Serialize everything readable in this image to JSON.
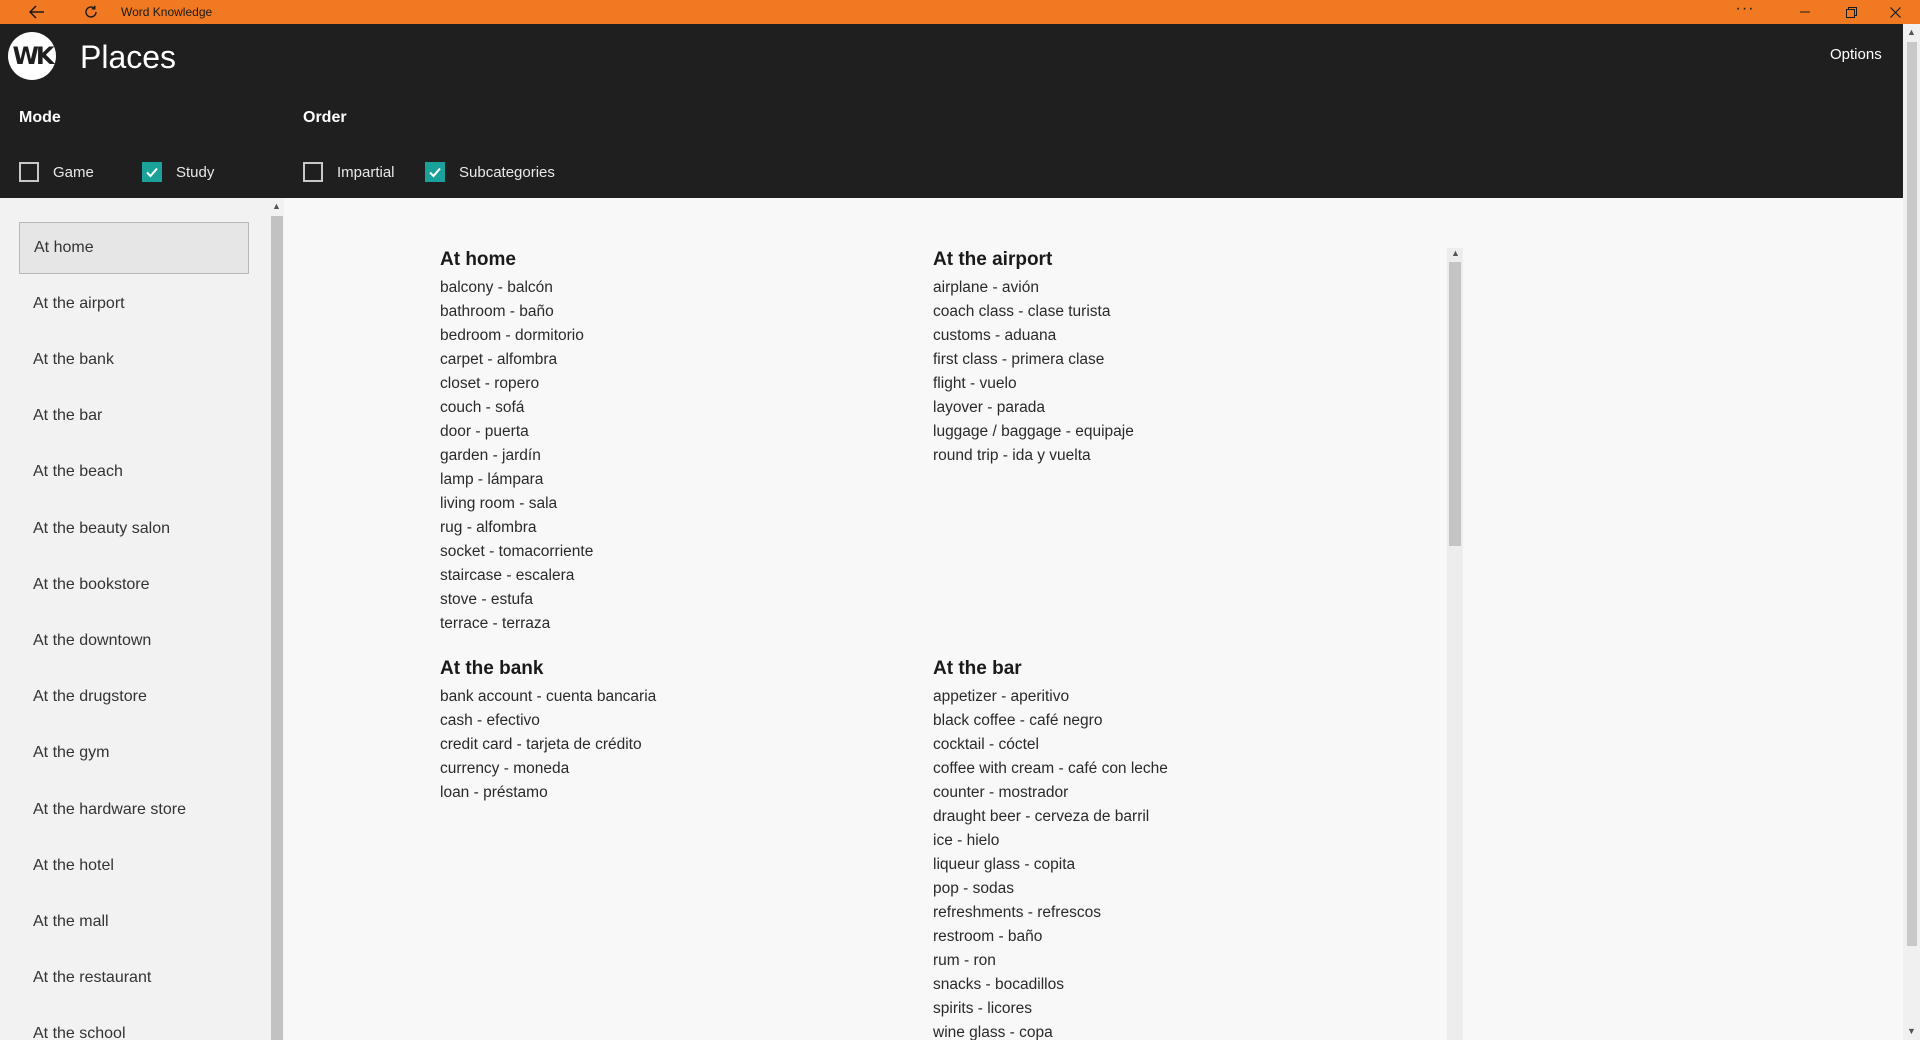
{
  "window": {
    "title": "Word Knowledge",
    "more_glyph": "···",
    "accent_color": "#f07921"
  },
  "header": {
    "logo_text": "WK",
    "page_title": "Places",
    "options_label": "Options",
    "mode": {
      "label": "Mode",
      "options": [
        {
          "label": "Game",
          "checked": false
        },
        {
          "label": "Study",
          "checked": true
        }
      ]
    },
    "order": {
      "label": "Order",
      "options": [
        {
          "label": "Impartial",
          "checked": false
        },
        {
          "label": "Subcategories",
          "checked": true
        }
      ]
    },
    "check_color": "#1aa199"
  },
  "sidebar": {
    "selected": "At home",
    "items": [
      "At home",
      "At the airport",
      "At the bank",
      "At the bar",
      "At the beach",
      "At the beauty salon",
      "At the bookstore",
      "At the downtown",
      "At the drugstore",
      "At the gym",
      "At the hardware store",
      "At the hotel",
      "At the mall",
      "At the restaurant",
      "At the school"
    ]
  },
  "categories": [
    {
      "title": "At home",
      "words": [
        "balcony - balcón",
        "bathroom - baño",
        "bedroom - dormitorio",
        "carpet - alfombra",
        "closet - ropero",
        "couch - sofá",
        "door - puerta",
        "garden - jardín",
        "lamp - lámpara",
        "living room - sala",
        "rug - alfombra",
        "socket - tomacorriente",
        "staircase - escalera",
        "stove - estufa",
        "terrace - terraza"
      ]
    },
    {
      "title": "At the airport",
      "words": [
        "airplane - avión",
        "coach class - clase turista",
        "customs - aduana",
        "first class - primera clase",
        "flight - vuelo",
        "layover - parada",
        "luggage / baggage - equipaje",
        "round trip - ida y vuelta"
      ]
    },
    {
      "title": "At the bank",
      "words": [
        "bank account - cuenta bancaria",
        "cash - efectivo",
        "credit card - tarjeta de crédito",
        "currency - moneda",
        "loan - préstamo"
      ]
    },
    {
      "title": "At the bar",
      "words": [
        "appetizer - aperitivo",
        "black coffee - café negro",
        "cocktail - cóctel",
        "coffee with cream - café con leche",
        "counter - mostrador",
        "draught beer - cerveza de barril",
        "ice - hielo",
        "liqueur glass - copita",
        "pop - sodas",
        "refreshments - refrescos",
        "restroom - baño",
        "rum - ron",
        "snacks - bocadillos",
        "spirits - licores",
        "wine glass - copa"
      ]
    }
  ]
}
